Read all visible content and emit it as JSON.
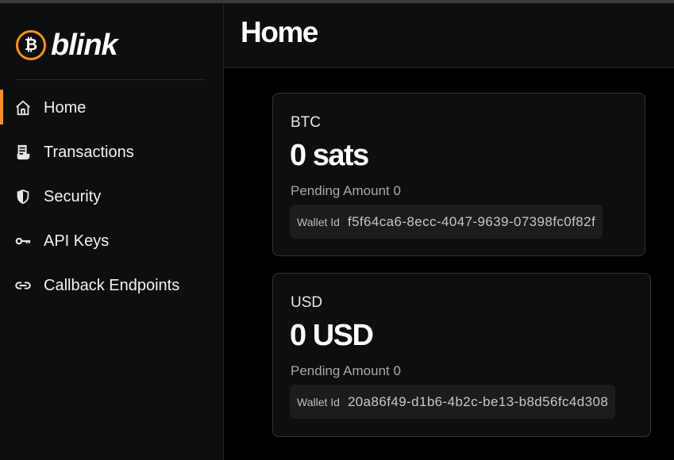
{
  "app": {
    "logo_text": "blink",
    "logo_symbol": "₿",
    "brand_color": "#f7931a"
  },
  "sidebar": {
    "items": [
      {
        "label": "Home",
        "icon": "home-icon",
        "active": true
      },
      {
        "label": "Transactions",
        "icon": "receipt-icon",
        "active": false
      },
      {
        "label": "Security",
        "icon": "shield-icon",
        "active": false
      },
      {
        "label": "API Keys",
        "icon": "key-icon",
        "active": false
      },
      {
        "label": "Callback Endpoints",
        "icon": "link-icon",
        "active": false
      }
    ]
  },
  "header": {
    "title": "Home"
  },
  "wallets": [
    {
      "currency": "BTC",
      "balance": "0 sats",
      "pending": "Pending Amount 0",
      "wallet_id_label": "Wallet Id",
      "wallet_id": "f5f64ca6-8ecc-4047-9639-07398fc0f82f"
    },
    {
      "currency": "USD",
      "balance": "0 USD",
      "pending": "Pending Amount 0",
      "wallet_id_label": "Wallet Id",
      "wallet_id": "20a86f49-d1b6-4b2c-be13-b8d56fc4d308"
    }
  ]
}
